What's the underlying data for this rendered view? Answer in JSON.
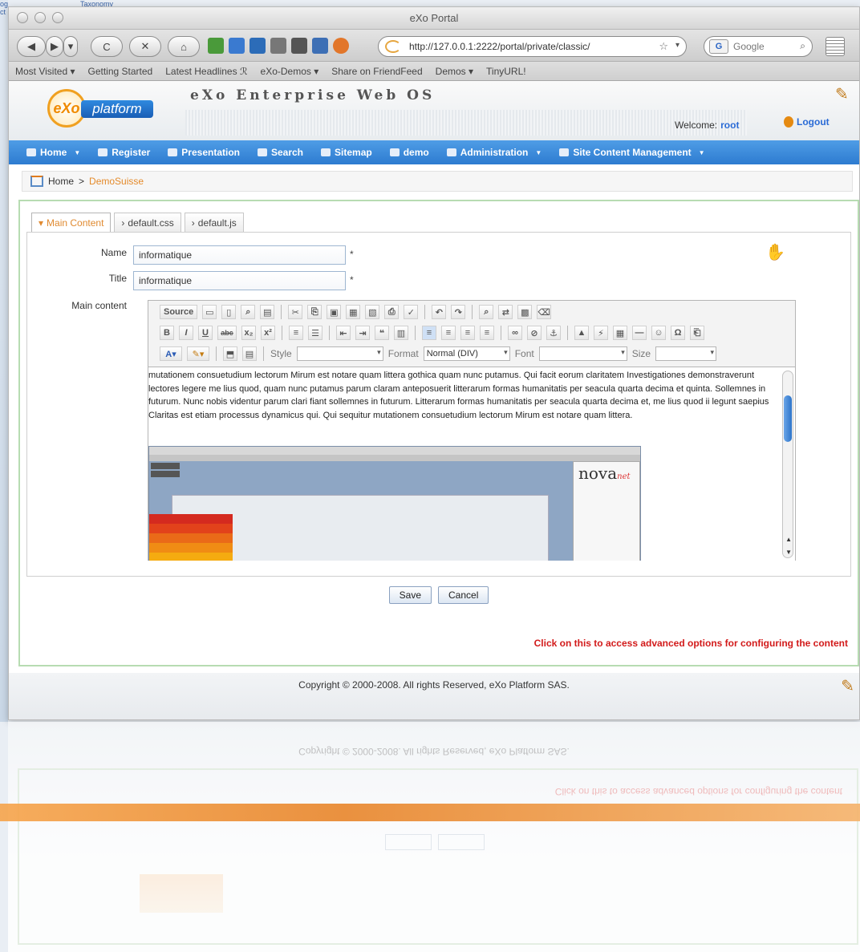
{
  "desktop": {
    "top_tab": "Taxonomy",
    "left_text": "og\nct"
  },
  "window": {
    "title": "eXo Portal"
  },
  "navbar": {
    "url": "http://127.0.0.1:2222/portal/private/classic/",
    "search_placeholder": "Google",
    "search_engine": "G",
    "nav_buttons": [
      "◀",
      "▶",
      "▾",
      "C",
      "✕",
      "⌂"
    ]
  },
  "bookmarks": [
    "Most Visited ▾",
    "Getting Started",
    "Latest Headlines ℛ",
    "eXo-Demos ▾",
    "Share on FriendFeed",
    "Demos ▾",
    "TinyURL!"
  ],
  "portal": {
    "logo_mark": "eXo",
    "logo_text": "platform",
    "title": "eXo Enterprise Web OS",
    "welcome_label": "Welcome:",
    "welcome_user": "root",
    "logout": "Logout",
    "nav": [
      {
        "label": "Home",
        "dropdown": true
      },
      {
        "label": "Register",
        "dropdown": false
      },
      {
        "label": "Presentation",
        "dropdown": false
      },
      {
        "label": "Search",
        "dropdown": false
      },
      {
        "label": "Sitemap",
        "dropdown": false
      },
      {
        "label": "demo",
        "dropdown": false
      },
      {
        "label": "Administration",
        "dropdown": true
      },
      {
        "label": "Site Content Management",
        "dropdown": true
      }
    ],
    "breadcrumb": {
      "home": "Home",
      "separator": ">",
      "current": "DemoSuisse"
    }
  },
  "form": {
    "tabs": [
      "Main Content",
      "default.css",
      "default.js"
    ],
    "name_label": "Name",
    "name_value": "informatique",
    "title_label": "Title",
    "title_value": "informatique",
    "main_content_label": "Main content",
    "required_mark": "*",
    "toolbar": {
      "source": "Source",
      "style_label": "Style",
      "format_label": "Format",
      "format_value": "Normal (DIV)",
      "font_label": "Font",
      "size_label": "Size",
      "bold": "B",
      "italic": "I",
      "underline": "U",
      "strike": "abc",
      "subscript": "x₂",
      "superscript": "x²",
      "quote": "❝",
      "omega": "Ω"
    },
    "content_text": "mutationem consuetudium lectorum Mirum est notare quam littera gothica quam nunc putamus. Qui facit eorum claritatem Investigationes demonstraverunt lectores legere me lius quod, quam nunc putamus parum claram anteposuerit litterarum formas humanitatis per seacula quarta decima et quinta. Sollemnes in futurum. Nunc nobis videntur parum clari fiant sollemnes in futurum. Litterarum formas humanitatis per seacula quarta decima et, me lius quod ii legunt saepius Claritas est etiam processus dynamicus qui. Qui sequitur mutationem consuetudium lectorum Mirum est notare quam littera.",
    "embedded_logo": "nova",
    "embedded_logo_suffix": "net",
    "save": "Save",
    "cancel": "Cancel",
    "advanced": "Click on this to access advanced options for configuring the content"
  },
  "footer": {
    "copyright": "Copyright © 2000-2008. All rights Reserved, eXo Platform SAS."
  },
  "colors": {
    "portal_nav": "#2d7bd0",
    "accent_orange": "#e48a2a",
    "advanced_link": "#d21a1a",
    "frame_green": "#b7dcb2"
  }
}
